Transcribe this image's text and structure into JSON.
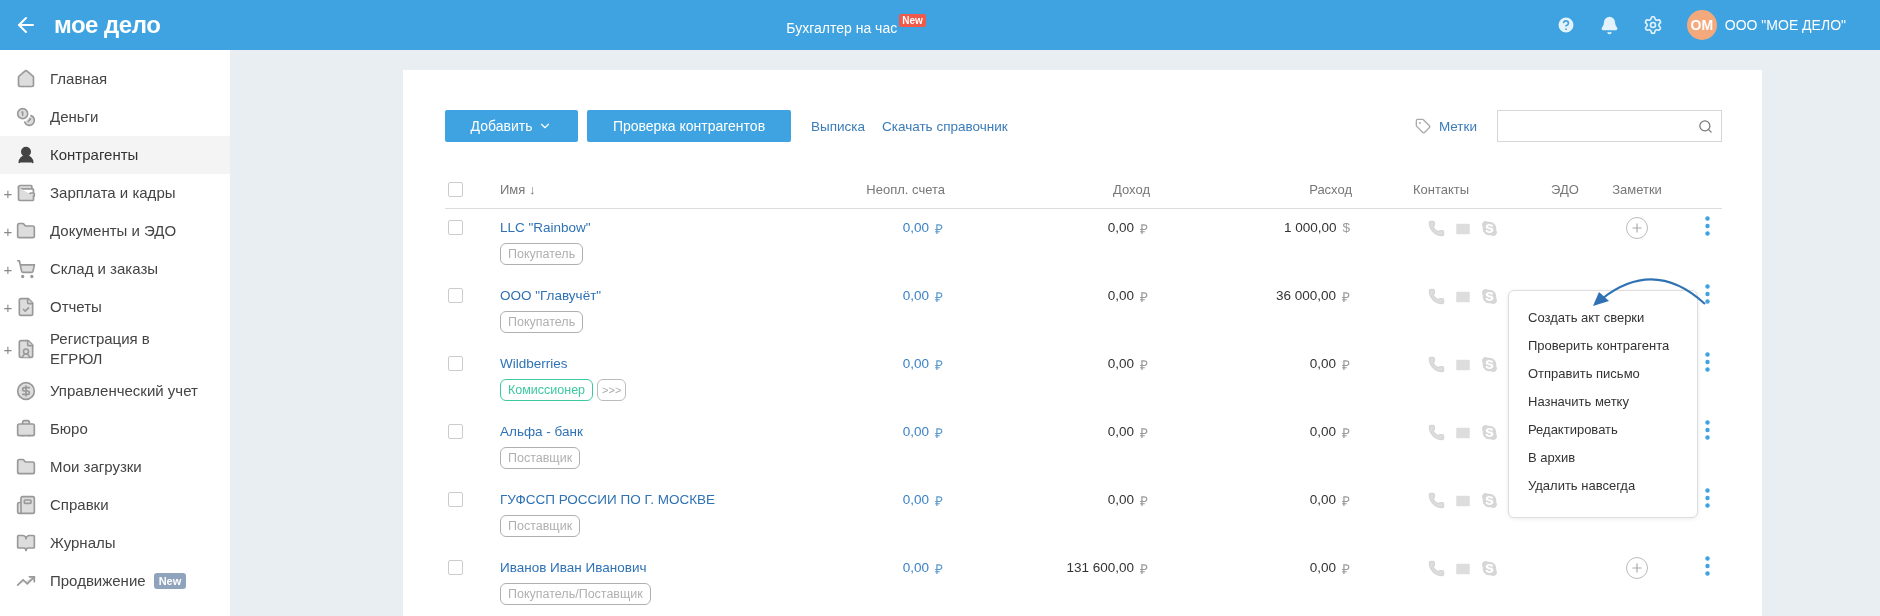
{
  "header": {
    "logo": "мое дело",
    "center_link": "Бухгалтер на час",
    "center_badge": "New",
    "avatar_initials": "ОМ",
    "company": "ООО \"МОЕ ДЕЛО\""
  },
  "sidebar": {
    "items": [
      {
        "label": "Главная",
        "selected": false
      },
      {
        "label": "Деньги",
        "selected": false
      },
      {
        "label": "Контрагенты",
        "selected": true
      },
      {
        "label": "Зарплата и кадры",
        "selected": false,
        "expander": "+"
      },
      {
        "label": "Документы и ЭДО",
        "selected": false,
        "expander": "+"
      },
      {
        "label": "Склад и заказы",
        "selected": false,
        "expander": "+"
      },
      {
        "label": "Отчеты",
        "selected": false,
        "expander": "+"
      },
      {
        "label": "Регистрация в ЕГРЮЛ",
        "selected": false,
        "expander": "+"
      },
      {
        "label": "Управленческий учет",
        "selected": false
      },
      {
        "label": "Бюро",
        "selected": false
      },
      {
        "label": "Мои загрузки",
        "selected": false
      },
      {
        "label": "Справки",
        "selected": false
      },
      {
        "label": "Журналы",
        "selected": false
      },
      {
        "label": "Продвижение",
        "selected": false,
        "badge": "New"
      }
    ]
  },
  "toolbar": {
    "add_button": "Добавить",
    "check_button": "Проверка контрагентов",
    "links": [
      "Выписка",
      "Скачать справочник"
    ],
    "tags_link": "Метки"
  },
  "table": {
    "select_all": {
      "checked": false
    },
    "columns": [
      "Имя ↓",
      "Неопл. счета",
      "Доход",
      "Расход",
      "Контакты",
      "ЭДО",
      "Заметки"
    ],
    "rows": [
      {
        "name": "LLC \"Rainbow\"",
        "checked": false,
        "tags": [
          {
            "label": "Покупатель",
            "color": "#b0b0b0"
          }
        ],
        "unpaid": {
          "amount": "0,00",
          "currency": "₽"
        },
        "income": {
          "amount": "0,00",
          "currency": "₽"
        },
        "expense": {
          "amount": "1 000,00",
          "currency": "$"
        },
        "note_button": true
      },
      {
        "name": "ООО \"Главучёт\"",
        "checked": false,
        "tags": [
          {
            "label": "Покупатель",
            "color": "#b0b0b0"
          }
        ],
        "unpaid": {
          "amount": "0,00",
          "currency": "₽"
        },
        "income": {
          "amount": "0,00",
          "currency": "₽"
        },
        "expense": {
          "amount": "36 000,00",
          "currency": "₽"
        },
        "note_button": false
      },
      {
        "name": "Wildberries",
        "checked": false,
        "tags": [
          {
            "label": "Комиссионер",
            "color": "#3cc9a0"
          }
        ],
        "more_tags": ">>>",
        "unpaid": {
          "amount": "0,00",
          "currency": "₽"
        },
        "income": {
          "amount": "0,00",
          "currency": "₽"
        },
        "expense": {
          "amount": "0,00",
          "currency": "₽"
        },
        "note_button": false
      },
      {
        "name": "Альфа - банк",
        "checked": false,
        "tags": [
          {
            "label": "Поставщик",
            "color": "#b0b0b0"
          }
        ],
        "unpaid": {
          "amount": "0,00",
          "currency": "₽"
        },
        "income": {
          "amount": "0,00",
          "currency": "₽"
        },
        "expense": {
          "amount": "0,00",
          "currency": "₽"
        },
        "note_button": false
      },
      {
        "name": "ГУФССП РОССИИ ПО Г. МОСКВЕ",
        "checked": false,
        "tags": [
          {
            "label": "Поставщик",
            "color": "#b0b0b0"
          }
        ],
        "unpaid": {
          "amount": "0,00",
          "currency": "₽"
        },
        "income": {
          "amount": "0,00",
          "currency": "₽"
        },
        "expense": {
          "amount": "0,00",
          "currency": "₽"
        },
        "note_button": false
      },
      {
        "name": "Иванов Иван Иванович",
        "checked": false,
        "tags": [
          {
            "label": "Покупатель/Поставщик",
            "color": "#b0b0b0"
          }
        ],
        "unpaid": {
          "amount": "0,00",
          "currency": "₽"
        },
        "income": {
          "amount": "131 600,00",
          "currency": "₽"
        },
        "expense": {
          "amount": "0,00",
          "currency": "₽"
        },
        "note_button": true
      }
    ]
  },
  "context_menu": {
    "items": [
      "Создать акт сверки",
      "Проверить контрагента",
      "Отправить письмо",
      "Назначить метку",
      "Редактировать",
      "В архив",
      "Удалить навсегда"
    ]
  }
}
